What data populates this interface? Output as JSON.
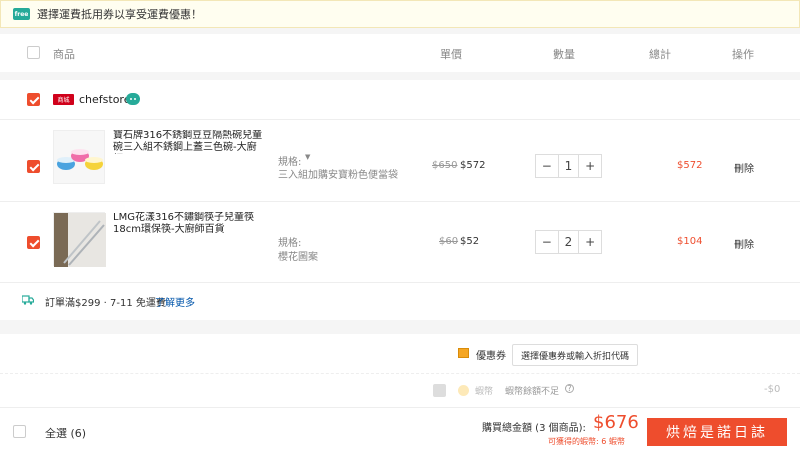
{
  "banner": {
    "badge": "free",
    "text": "選擇運費抵用券以享受運費優惠！"
  },
  "header": {
    "product": "商品",
    "unit_price": "單價",
    "quantity": "數量",
    "subtotal": "總計",
    "action": "操作"
  },
  "shop": {
    "mall_badge": "商城",
    "name": "chefstores"
  },
  "items": [
    {
      "name": "寶石牌316不銹鋼豆豆隔熱碗兒童碗三入組不銹鋼上蓋三色碗-大廚師...",
      "spec_label": "規格:",
      "spec_value": "三入組加購安寶粉色便當袋",
      "old_price": "$650",
      "price": "$572",
      "qty": "1",
      "total": "$572",
      "delete": "刪除"
    },
    {
      "name": "LMG花漾316不鏽鋼筷子兒童筷18cm環保筷-大廚師百貨",
      "spec_label": "規格:",
      "spec_value": "櫻花圖案",
      "old_price": "$60",
      "price": "$52",
      "qty": "2",
      "total": "$104",
      "delete": "刪除"
    }
  ],
  "qty_controls": {
    "minus": "−",
    "plus": "+"
  },
  "shipping": {
    "text": "訂單滿$299 · 7-11 免運費",
    "link": "了解更多"
  },
  "voucher": {
    "label": "優惠券",
    "button": "選擇優惠券或輸入折扣代碼"
  },
  "coins": {
    "label": "蝦幣",
    "note": "蝦幣餘額不足",
    "amount": "-$0"
  },
  "summary": {
    "select_all": "全選 (6)",
    "total_label": "購買總金額 (3 個商品):",
    "total_value": "$676",
    "coins_earn": "可獲得的蝦幣: 6 蝦幣",
    "checkout": "烘焙是諾日誌"
  },
  "colors": {
    "accent": "#ee4d2d",
    "teal": "#26aa99",
    "mall": "#d0011b"
  }
}
